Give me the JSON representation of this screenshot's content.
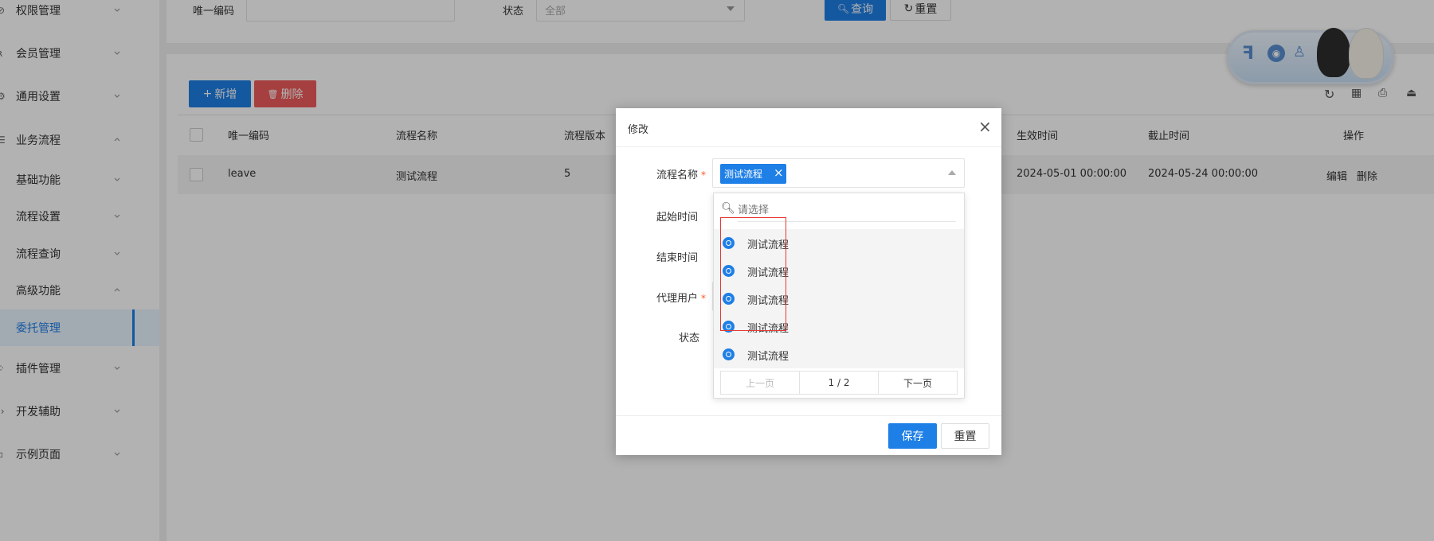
{
  "sidebar": {
    "items": [
      {
        "label": "权限管理",
        "icon": "shield-icon",
        "chevron": "down"
      },
      {
        "label": "会员管理",
        "icon": "user-icon",
        "chevron": "down"
      },
      {
        "label": "通用设置",
        "icon": "gear-icon",
        "chevron": "down"
      },
      {
        "label": "业务流程",
        "icon": "list-icon",
        "chevron": "up"
      },
      {
        "label": "基础功能",
        "chevron": "down"
      },
      {
        "label": "流程设置",
        "chevron": "down"
      },
      {
        "label": "流程查询",
        "chevron": "down"
      },
      {
        "label": "高级功能",
        "chevron": "up"
      },
      {
        "label": "委托管理",
        "active": true
      },
      {
        "label": "插件管理",
        "icon": "puzzle-icon",
        "chevron": "down"
      },
      {
        "label": "开发辅助",
        "icon": "code-icon",
        "chevron": "down"
      },
      {
        "label": "示例页面",
        "icon": "page-icon",
        "chevron": "down"
      }
    ]
  },
  "search": {
    "code_label": "唯一编码",
    "status_label": "状态",
    "status_placeholder": "全部",
    "query_button": "查询",
    "reset_button": "重置"
  },
  "toolbar": {
    "add_button": "新增",
    "delete_button": "删除"
  },
  "table": {
    "headers": [
      "唯一编码",
      "流程名称",
      "流程版本",
      "生效时间",
      "截止时间",
      "操作"
    ],
    "rows": [
      {
        "code": "leave",
        "name": "测试流程",
        "version": "5",
        "start": "2024-05-01 00:00:00",
        "end": "2024-05-24 00:00:00",
        "edit": "编辑",
        "delete": "删除"
      }
    ]
  },
  "modal": {
    "title": "修改",
    "fields": {
      "flow_name_label": "流程名称",
      "start_time_label": "起始时间",
      "end_time_label": "结束时间",
      "agent_user_label": "代理用户",
      "status_label": "状态"
    },
    "selected_tag": "测试流程",
    "search_placeholder": "请选择",
    "options": [
      "测试流程",
      "测试流程",
      "测试流程",
      "测试流程",
      "测试流程"
    ],
    "pagination": {
      "prev": "上一页",
      "page": "1 / 2",
      "next": "下一页"
    },
    "save_button": "保存",
    "reset_button": "重置"
  },
  "colors": {
    "primary": "#1e7fe6",
    "danger": "#ee5c5c",
    "required": "#ff5722"
  }
}
